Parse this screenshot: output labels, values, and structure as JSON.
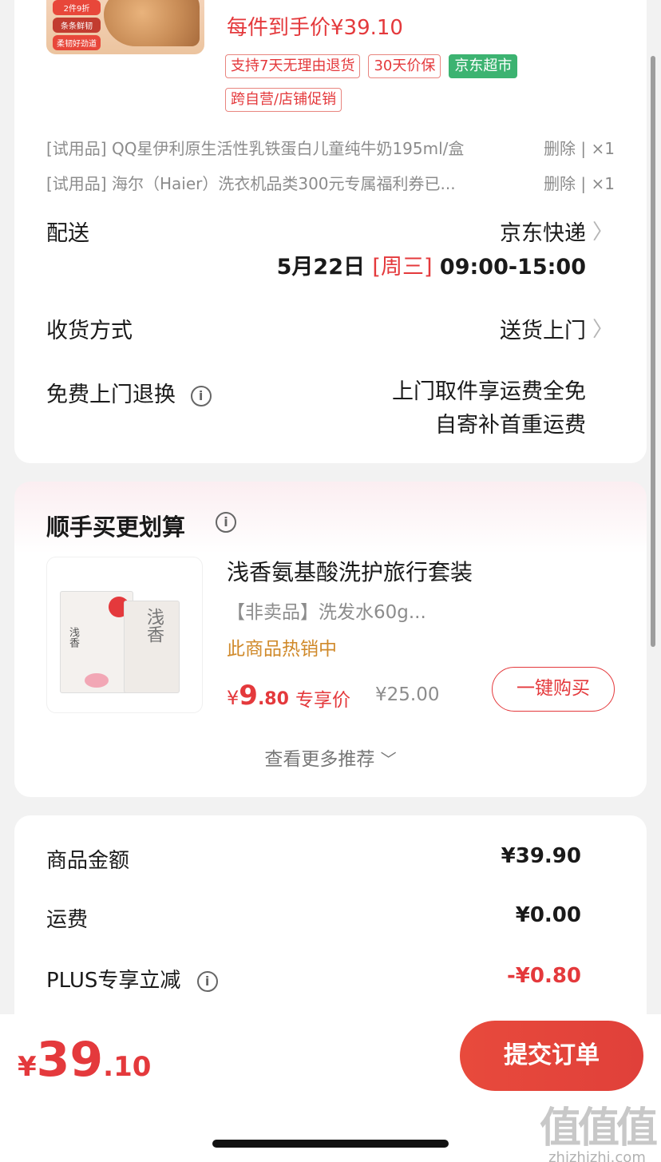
{
  "order": {
    "thumb_promo": [
      "2件9折",
      "条条鲜韧",
      "柔韧好劲道"
    ],
    "each_price": "每件到手价¥39.10",
    "tags": [
      {
        "label": "支持7天无理由退货",
        "style": "outline"
      },
      {
        "label": "30天价保",
        "style": "outline"
      },
      {
        "label": "京东超市",
        "style": "green"
      },
      {
        "label": "跨自营/店铺促销",
        "style": "outline"
      }
    ],
    "trial_items": [
      {
        "name": "[试用品]  QQ星伊利原生活性乳铁蛋白儿童纯牛奶195ml/盒",
        "ops": "删除 | ×1"
      },
      {
        "name": "[试用品]  海尔（Haier）洗衣机品类300元专属福利券已...",
        "ops": "删除 | ×1"
      }
    ],
    "delivery": {
      "label": "配送",
      "carrier": "京东快递",
      "date": "5月22日",
      "weekday": "[周三]",
      "time_window": "09:00-15:00"
    },
    "receive": {
      "label": "收货方式",
      "value": "送货上门"
    },
    "free_return": {
      "label": "免费上门退换",
      "line1": "上门取件享运费全免",
      "line2": "自寄补首重运费"
    }
  },
  "recommend": {
    "title": "顺手买更划算",
    "item": {
      "name": "浅香氨基酸洗护旅行套装",
      "sub": "【非卖品】洗发水60g...",
      "hot": "此商品热销中",
      "price_currency": "¥",
      "price_int": "9",
      "price_dec": ".80",
      "exclusive": "专享价",
      "orig_price": "¥25.00",
      "buy_label": "一键购买",
      "thumb_brand": "浅香"
    },
    "more": "查看更多推荐"
  },
  "summary": {
    "rows": [
      {
        "label": "商品金额",
        "value": "¥39.90"
      },
      {
        "label": "运费",
        "value": "¥0.00"
      },
      {
        "label": "PLUS专享立减",
        "value": "-¥0.80"
      }
    ]
  },
  "bottom": {
    "total_currency": "¥",
    "total_int": "39",
    "total_dec": ".10",
    "submit_label": "提交订单"
  },
  "watermark": {
    "logo": "值值值",
    "url": "zhizhizhi.com"
  },
  "colors": {
    "accent": "#e4393c",
    "green_tag": "#3cb371",
    "hot": "#d08a2b"
  }
}
